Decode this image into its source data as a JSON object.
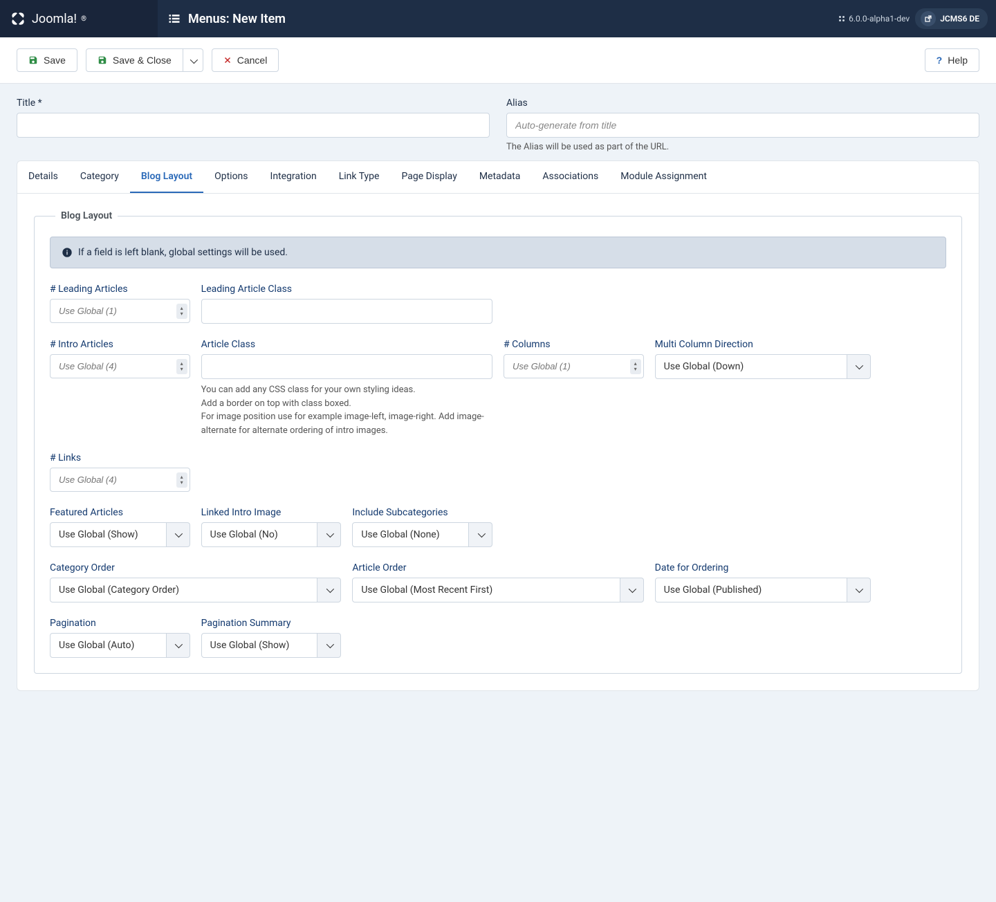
{
  "header": {
    "brand": "Joomla!",
    "title": "Menus: New Item",
    "version": "6.0.0-alpha1-dev",
    "user": "JCMS6 DE"
  },
  "toolbar": {
    "save": "Save",
    "save_close": "Save & Close",
    "cancel": "Cancel",
    "help": "Help"
  },
  "title_field": {
    "label": "Title *",
    "value": ""
  },
  "alias_field": {
    "label": "Alias",
    "placeholder": "Auto-generate from title",
    "help": "The Alias will be used as part of the URL."
  },
  "tabs": [
    "Details",
    "Category",
    "Blog Layout",
    "Options",
    "Integration",
    "Link Type",
    "Page Display",
    "Metadata",
    "Associations",
    "Module Assignment"
  ],
  "active_tab_index": 2,
  "fieldset": {
    "legend": "Blog Layout",
    "info": "If a field is left blank, global settings will be used."
  },
  "fields": {
    "leading_articles": {
      "label": "# Leading Articles",
      "placeholder": "Use Global (1)"
    },
    "leading_class": {
      "label": "Leading Article Class",
      "value": ""
    },
    "intro_articles": {
      "label": "# Intro Articles",
      "placeholder": "Use Global (4)"
    },
    "article_class": {
      "label": "Article Class",
      "value": "",
      "help": "You can add any CSS class for your own styling ideas.\nAdd a border on top with class boxed.\nFor image position use for example image-left, image-right. Add image-alternate for alternate ordering of intro images."
    },
    "columns": {
      "label": "# Columns",
      "placeholder": "Use Global (1)"
    },
    "multi_col_dir": {
      "label": "Multi Column Direction",
      "value": "Use Global (Down)"
    },
    "links": {
      "label": "# Links",
      "placeholder": "Use Global (4)"
    },
    "featured": {
      "label": "Featured Articles",
      "value": "Use Global (Show)"
    },
    "linked_intro": {
      "label": "Linked Intro Image",
      "value": "Use Global (No)"
    },
    "include_subcat": {
      "label": "Include Subcategories",
      "value": "Use Global (None)"
    },
    "category_order": {
      "label": "Category Order",
      "value": "Use Global (Category Order)"
    },
    "article_order": {
      "label": "Article Order",
      "value": "Use Global (Most Recent First)"
    },
    "date_ordering": {
      "label": "Date for Ordering",
      "value": "Use Global (Published)"
    },
    "pagination": {
      "label": "Pagination",
      "value": "Use Global (Auto)"
    },
    "pagination_summary": {
      "label": "Pagination Summary",
      "value": "Use Global (Show)"
    }
  }
}
